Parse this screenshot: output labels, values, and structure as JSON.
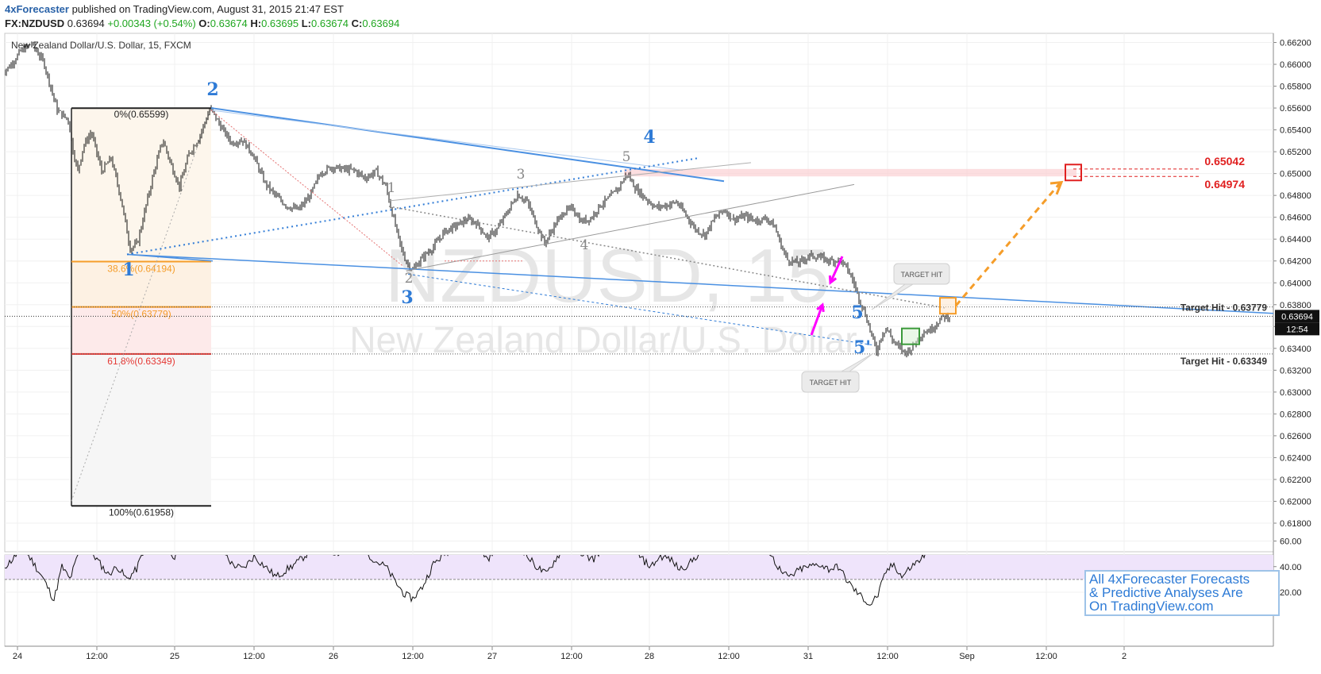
{
  "header": {
    "brand": "4xForecaster",
    "published": " published on TradingView.com, August 31, 2015 21:47 EST",
    "symbol": "FX:NZDUSD",
    "price": "0.63694",
    "change": "+0.00343 (+0.54%)",
    "o_label": "O:",
    "o_value": "0.63674",
    "h_label": "H:",
    "h_value": "0.63695",
    "l_label": "L:",
    "l_value": "0.63674",
    "c_label": "C:",
    "c_value": "0.63694"
  },
  "main_chart": {
    "title": "New Zealand Dollar/U.S. Dollar, 15, FXCM",
    "watermark_symbol": "NZDUSD, 15",
    "watermark_name": "New Zealand Dollar/U.S. Dollar",
    "current_price_label": "0.63694",
    "countdown_label": "12:54"
  },
  "fibonacci": [
    {
      "label": "0%(0.65599)",
      "value": 0.65599,
      "color": "#222222"
    },
    {
      "label": "38.6%(0.64194)",
      "value": 0.64194,
      "color": "#f59d2a"
    },
    {
      "label": "50%(0.63779)",
      "value": 0.63779,
      "color": "#f59d2a"
    },
    {
      "label": "61.8%(0.63349)",
      "value": 0.63349,
      "color": "#e53935"
    },
    {
      "label": "100%(0.61958)",
      "value": 0.61958,
      "color": "#222222"
    }
  ],
  "annotations": {
    "wave_labels_blue": [
      "1",
      "2",
      "3",
      "4",
      "5",
      "5'"
    ],
    "wave_labels_gray": [
      "1",
      "2",
      "3",
      "4",
      "5"
    ],
    "target_hit_upper": "Target Hit - 0.63779",
    "target_hit_lower": "Target Hit - 0.63349",
    "callout_upper": "TARGET HIT",
    "callout_lower": "TARGET HIT",
    "target_high": "0.65042",
    "target_low": "0.64974"
  },
  "ad_box": {
    "line1": "All 4xForecaster Forecasts",
    "line2": "& Predictive Analyses Are",
    "line3": "On TradingView.com"
  },
  "colors": {
    "wave_blue": "#2f7bd6",
    "channel_blue": "#4a90e2",
    "fib_orange": "#f59d2a",
    "fib_red": "#e53935",
    "target_red": "#e02020",
    "magenta": "#ff00ff",
    "rsi_fill": "#efe4fb"
  },
  "chart_data": [
    {
      "type": "candlestick",
      "title": "New Zealand Dollar/U.S. Dollar, 15, FXCM",
      "x_tick_labels": [
        "24",
        "12:00",
        "25",
        "12:00",
        "26",
        "12:00",
        "27",
        "12:00",
        "28",
        "12:00",
        "31",
        "12:00",
        "Sep",
        "12:00",
        "2"
      ],
      "y_tick_labels": [
        "0.66200",
        "0.66000",
        "0.65800",
        "0.65600",
        "0.65400",
        "0.65200",
        "0.65000",
        "0.64800",
        "0.64600",
        "0.64400",
        "0.64200",
        "0.64000",
        "0.63800",
        "0.63600",
        "0.63400",
        "0.63200",
        "0.63000",
        "0.62800",
        "0.62600",
        "0.62400",
        "0.62200",
        "0.62000",
        "0.61800"
      ],
      "ylim": [
        0.6174,
        0.6629
      ],
      "close_path": [
        [
          0.6592,
          2
        ],
        [
          0.6598,
          12
        ],
        [
          0.6612,
          26
        ],
        [
          0.6619,
          40
        ],
        [
          0.6602,
          55
        ],
        [
          0.6558,
          72
        ],
        [
          0.6549,
          86
        ],
        [
          0.6521,
          92
        ],
        [
          0.6502,
          98
        ],
        [
          0.6525,
          105
        ],
        [
          0.6538,
          115
        ],
        [
          0.6502,
          128
        ],
        [
          0.6514,
          140
        ],
        [
          0.6478,
          152
        ],
        [
          0.6431,
          164
        ],
        [
          0.6436,
          173
        ],
        [
          0.6468,
          183
        ],
        [
          0.6502,
          194
        ],
        [
          0.6531,
          205
        ],
        [
          0.6509,
          215
        ],
        [
          0.6488,
          226
        ],
        [
          0.6518,
          238
        ],
        [
          0.6532,
          250
        ],
        [
          0.656,
          265
        ],
        [
          0.6543,
          278
        ],
        [
          0.6528,
          292
        ],
        [
          0.6531,
          305
        ],
        [
          0.6518,
          318
        ],
        [
          0.6491,
          334
        ],
        [
          0.6479,
          348
        ],
        [
          0.647,
          362
        ],
        [
          0.6467,
          376
        ],
        [
          0.6479,
          390
        ],
        [
          0.6501,
          404
        ],
        [
          0.6506,
          418
        ],
        [
          0.6504,
          432
        ],
        [
          0.6503,
          446
        ],
        [
          0.6496,
          460
        ],
        [
          0.6502,
          474
        ],
        [
          0.6488,
          486
        ],
        [
          0.6458,
          496
        ],
        [
          0.6432,
          505
        ],
        [
          0.6419,
          512
        ],
        [
          0.6412,
          520
        ],
        [
          0.6423,
          532
        ],
        [
          0.6433,
          546
        ],
        [
          0.6447,
          560
        ],
        [
          0.6452,
          574
        ],
        [
          0.6458,
          588
        ],
        [
          0.6455,
          600
        ],
        [
          0.6441,
          614
        ],
        [
          0.6449,
          626
        ],
        [
          0.6466,
          640
        ],
        [
          0.6481,
          652
        ],
        [
          0.6474,
          664
        ],
        [
          0.6453,
          676
        ],
        [
          0.6436,
          686
        ],
        [
          0.6452,
          698
        ],
        [
          0.6465,
          710
        ],
        [
          0.6468,
          722
        ],
        [
          0.6456,
          732
        ],
        [
          0.6459,
          744
        ],
        [
          0.6471,
          756
        ],
        [
          0.6478,
          768
        ],
        [
          0.6488,
          780
        ],
        [
          0.65,
          790
        ],
        [
          0.6487,
          800
        ],
        [
          0.6478,
          812
        ],
        [
          0.6469,
          826
        ],
        [
          0.6471,
          840
        ],
        [
          0.6474,
          852
        ],
        [
          0.6462,
          864
        ],
        [
          0.6449,
          876
        ],
        [
          0.6444,
          888
        ],
        [
          0.6459,
          900
        ],
        [
          0.6467,
          912
        ],
        [
          0.6458,
          924
        ],
        [
          0.6461,
          938
        ],
        [
          0.6457,
          952
        ],
        [
          0.6459,
          966
        ],
        [
          0.6451,
          976
        ],
        [
          0.6434,
          984
        ],
        [
          0.6421,
          992
        ],
        [
          0.6418,
          1006
        ],
        [
          0.6425,
          1020
        ],
        [
          0.6423,
          1034
        ],
        [
          0.642,
          1046
        ],
        [
          0.6421,
          1058
        ],
        [
          0.6412,
          1068
        ],
        [
          0.6399,
          1076
        ],
        [
          0.6386,
          1082
        ],
        [
          0.6371,
          1090
        ],
        [
          0.6352,
          1098
        ],
        [
          0.6337,
          1104
        ],
        [
          0.6351,
          1110
        ],
        [
          0.6359,
          1116
        ],
        [
          0.6348,
          1124
        ],
        [
          0.6341,
          1132
        ],
        [
          0.6336,
          1140
        ],
        [
          0.634,
          1148
        ],
        [
          0.6349,
          1156
        ],
        [
          0.6355,
          1164
        ],
        [
          0.6357,
          1172
        ],
        [
          0.6363,
          1180
        ],
        [
          0.6369,
          1188
        ],
        [
          0.6369,
          1196
        ]
      ],
      "series": [
        {
          "name": "",
          "type": "line",
          "points": [
            [
              0.6426,
              164
            ],
            [
              0.6512,
              875
            ]
          ],
          "color": "#2f7bd6"
        },
        {
          "name": "",
          "type": "line",
          "points": [
            [
              0.656,
              265
            ],
            [
              0.6493,
              912
            ]
          ],
          "color": "#4a90e2"
        },
        {
          "name": "",
          "type": "line",
          "points": [
            [
              0.6426,
              160
            ],
            [
              0.6372,
              1510
            ]
          ],
          "color": "#4a90e2"
        }
      ],
      "horizontal_levels": [
        0.63779,
        0.63349,
        0.63694
      ],
      "target_zone": [
        0.64974,
        0.65042
      ],
      "grid": true
    },
    {
      "type": "line",
      "title": "",
      "y_tick_labels": [
        "60.00",
        "40.00",
        "20.00"
      ],
      "ylim": [
        5,
        75
      ],
      "bands": [
        30,
        70
      ],
      "values_path": [
        [
          38,
          2
        ],
        [
          45,
          15
        ],
        [
          55,
          28
        ],
        [
          45,
          40
        ],
        [
          30,
          55
        ],
        [
          14,
          68
        ],
        [
          40,
          78
        ],
        [
          30,
          88
        ],
        [
          52,
          100
        ],
        [
          54,
          112
        ],
        [
          44,
          124
        ],
        [
          34,
          136
        ],
        [
          40,
          148
        ],
        [
          30,
          160
        ],
        [
          38,
          172
        ],
        [
          58,
          184
        ],
        [
          66,
          196
        ],
        [
          55,
          208
        ],
        [
          48,
          220
        ],
        [
          56,
          232
        ],
        [
          60,
          244
        ],
        [
          62,
          256
        ],
        [
          66,
          266
        ],
        [
          56,
          278
        ],
        [
          42,
          292
        ],
        [
          38,
          306
        ],
        [
          48,
          320
        ],
        [
          40,
          334
        ],
        [
          32,
          348
        ],
        [
          38,
          362
        ],
        [
          44,
          376
        ],
        [
          52,
          390
        ],
        [
          60,
          404
        ],
        [
          52,
          418
        ],
        [
          50,
          432
        ],
        [
          56,
          446
        ],
        [
          52,
          460
        ],
        [
          44,
          474
        ],
        [
          40,
          486
        ],
        [
          28,
          498
        ],
        [
          18,
          510
        ],
        [
          15,
          520
        ],
        [
          24,
          532
        ],
        [
          42,
          546
        ],
        [
          50,
          560
        ],
        [
          56,
          574
        ],
        [
          60,
          588
        ],
        [
          58,
          600
        ],
        [
          46,
          614
        ],
        [
          54,
          626
        ],
        [
          58,
          640
        ],
        [
          60,
          652
        ],
        [
          48,
          664
        ],
        [
          40,
          676
        ],
        [
          34,
          688
        ],
        [
          46,
          700
        ],
        [
          56,
          712
        ],
        [
          58,
          724
        ],
        [
          48,
          736
        ],
        [
          46,
          748
        ],
        [
          56,
          760
        ],
        [
          64,
          772
        ],
        [
          70,
          784
        ],
        [
          58,
          796
        ],
        [
          46,
          808
        ],
        [
          40,
          820
        ],
        [
          48,
          832
        ],
        [
          46,
          844
        ],
        [
          38,
          856
        ],
        [
          42,
          868
        ],
        [
          50,
          880
        ],
        [
          54,
          892
        ],
        [
          58,
          904
        ],
        [
          52,
          916
        ],
        [
          56,
          928
        ],
        [
          58,
          940
        ],
        [
          52,
          952
        ],
        [
          56,
          964
        ],
        [
          44,
          976
        ],
        [
          34,
          986
        ],
        [
          32,
          996
        ],
        [
          38,
          1008
        ],
        [
          40,
          1020
        ],
        [
          42,
          1032
        ],
        [
          38,
          1044
        ],
        [
          40,
          1056
        ],
        [
          30,
          1066
        ],
        [
          22,
          1076
        ],
        [
          16,
          1086
        ],
        [
          10,
          1096
        ],
        [
          18,
          1106
        ],
        [
          36,
          1116
        ],
        [
          42,
          1126
        ],
        [
          32,
          1136
        ],
        [
          40,
          1148
        ],
        [
          46,
          1160
        ],
        [
          54,
          1172
        ],
        [
          60,
          1184
        ],
        [
          62,
          1192
        ],
        [
          60,
          1198
        ]
      ],
      "grid": true
    }
  ]
}
